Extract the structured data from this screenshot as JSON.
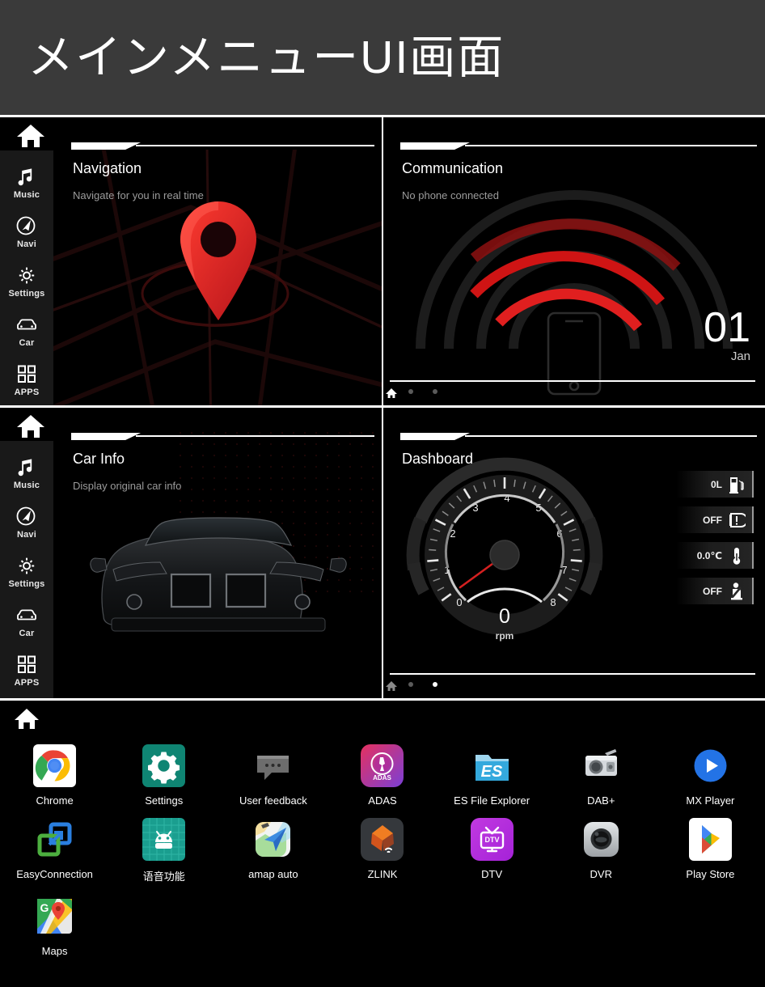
{
  "banner": {
    "title": "メインメニューUI画面"
  },
  "sidebar": {
    "home_icon": "home-icon",
    "items": [
      {
        "label": "Music",
        "icon": "music-note-icon"
      },
      {
        "label": "Navi",
        "icon": "navigation-compass-icon"
      },
      {
        "label": "Settings",
        "icon": "gear-icon"
      },
      {
        "label": "Car",
        "icon": "car-front-icon"
      },
      {
        "label": "APPS",
        "icon": "grid-apps-icon"
      }
    ]
  },
  "panels": [
    {
      "page_index": 1,
      "dots": [
        false,
        false
      ],
      "cards": [
        {
          "title": "Navigation",
          "subtitle": "Navigate for you in real time",
          "art": "map-pin-art"
        },
        {
          "title": "Communication",
          "subtitle": "No phone connected",
          "art": "phone-waves-art",
          "date": {
            "day": "01",
            "month": "Jan"
          }
        }
      ]
    },
    {
      "page_index": 2,
      "dots": [
        false,
        true
      ],
      "cards": [
        {
          "title": "Car Info",
          "subtitle": "Display original car info",
          "art": "car-art"
        },
        {
          "title": "Dashboard",
          "subtitle": "",
          "art": "tachometer-art"
        }
      ]
    }
  ],
  "dashboard": {
    "gauge": {
      "ticks": [
        "0",
        "1",
        "2",
        "3",
        "4",
        "5",
        "6",
        "7",
        "8"
      ],
      "value": "0",
      "unit": "rpm",
      "needle_color": "#d42020"
    },
    "status": [
      {
        "value": "0L",
        "icon": "fuel-pump-icon"
      },
      {
        "value": "OFF",
        "icon": "tire-pressure-icon"
      },
      {
        "value": "0.0℃",
        "icon": "thermometer-icon"
      },
      {
        "value": "OFF",
        "icon": "seatbelt-icon"
      }
    ]
  },
  "app_drawer": {
    "home_icon": "home-icon",
    "apps": [
      {
        "label": "Chrome",
        "icon": "chrome-icon"
      },
      {
        "label": "Settings",
        "icon": "settings-gear-icon"
      },
      {
        "label": "User feedback",
        "icon": "feedback-chat-icon"
      },
      {
        "label": "ADAS",
        "icon": "adas-icon"
      },
      {
        "label": "ES File Explorer",
        "icon": "es-file-explorer-icon"
      },
      {
        "label": "DAB+",
        "icon": "radio-icon"
      },
      {
        "label": "MX Player",
        "icon": "mx-player-icon"
      },
      {
        "label": "EasyConnection",
        "icon": "easyconnection-icon"
      },
      {
        "label": "语音功能",
        "icon": "voice-android-icon"
      },
      {
        "label": "amap auto",
        "icon": "amap-icon"
      },
      {
        "label": "ZLINK",
        "icon": "zlink-icon"
      },
      {
        "label": "DTV",
        "icon": "dtv-icon"
      },
      {
        "label": "DVR",
        "icon": "dvr-camera-icon"
      },
      {
        "label": "Play Store",
        "icon": "play-store-icon"
      },
      {
        "label": "Maps",
        "icon": "google-maps-icon"
      }
    ]
  },
  "colors": {
    "banner_bg": "#3a3a3a",
    "accent_red": "#e01f1f",
    "sidebar_bg": "#191919",
    "panel_bg": "#000000"
  }
}
